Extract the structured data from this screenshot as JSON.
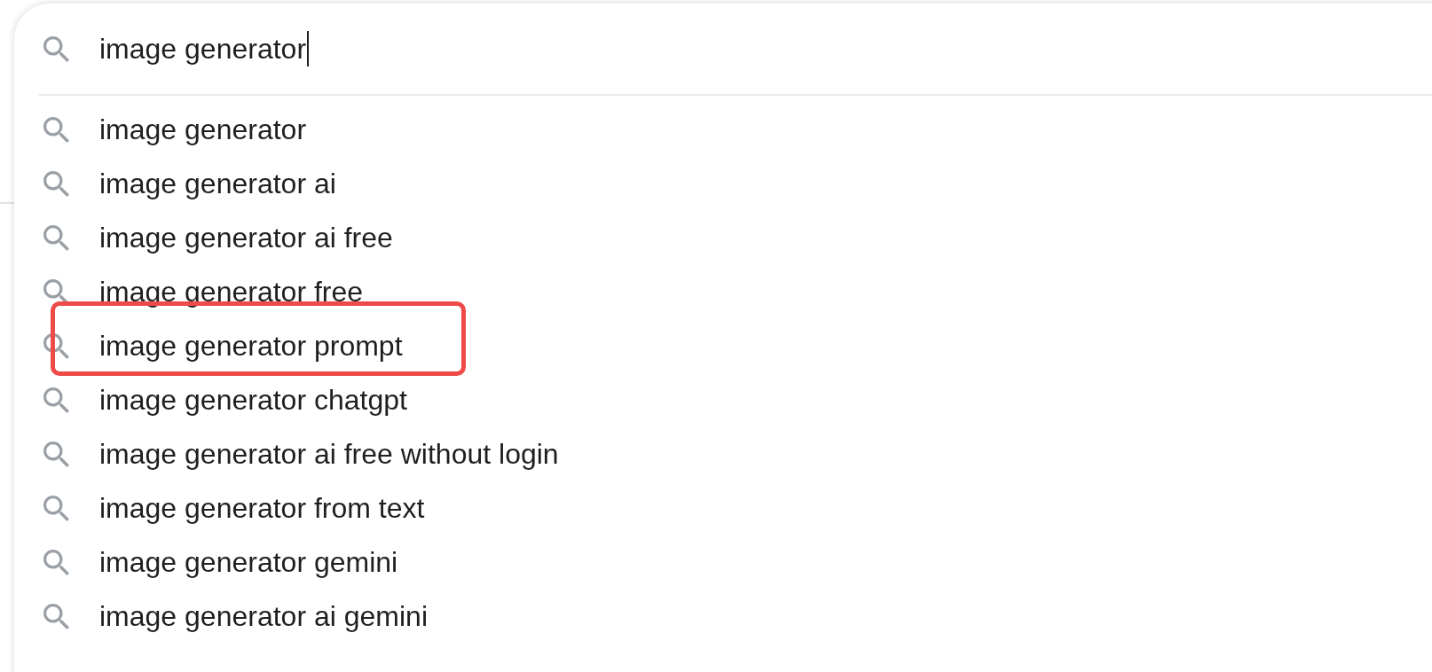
{
  "search": {
    "value": "image generator",
    "focused": true
  },
  "suggestions": [
    {
      "text": "image generator",
      "annotated": false
    },
    {
      "text": "image generator ai",
      "annotated": false
    },
    {
      "text": "image generator ai free",
      "annotated": false
    },
    {
      "text": "image generator free",
      "annotated": false
    },
    {
      "text": "image generator prompt",
      "annotated": true
    },
    {
      "text": "image generator chatgpt",
      "annotated": false
    },
    {
      "text": "image generator ai free without login",
      "annotated": false
    },
    {
      "text": "image generator from text",
      "annotated": false
    },
    {
      "text": "image generator gemini",
      "annotated": false
    },
    {
      "text": "image generator ai gemini",
      "annotated": false
    }
  ]
}
